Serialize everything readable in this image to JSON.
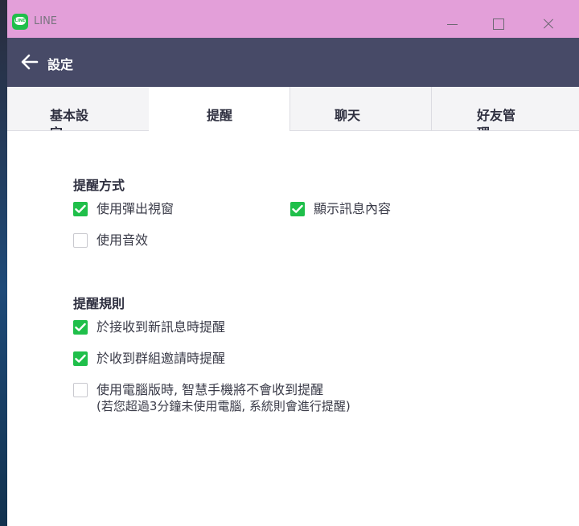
{
  "window": {
    "app_title": "LINE",
    "logo_text": "LINE",
    "accent_color": "#e39fd9",
    "header_color": "#474a67",
    "check_color": "#1fbf4a"
  },
  "header": {
    "title": "設定"
  },
  "tabs": [
    {
      "label": "基本設定",
      "active": false
    },
    {
      "label": "提醒",
      "active": true
    },
    {
      "label": "聊天",
      "active": false
    },
    {
      "label": "好友管理",
      "active": false
    }
  ],
  "sections": {
    "method": {
      "title": "提醒方式",
      "options": [
        {
          "label": "使用彈出視窗",
          "checked": true
        },
        {
          "label": "顯示訊息內容",
          "checked": true
        },
        {
          "label": "使用音效",
          "checked": false
        }
      ]
    },
    "rules": {
      "title": "提醒規則",
      "options": [
        {
          "label": "於接收到新訊息時提醒",
          "checked": true
        },
        {
          "label": "於收到群組邀請時提醒",
          "checked": true
        },
        {
          "label": "使用電腦版時, 智慧手機將不會收到提醒",
          "label_line2": "(若您超過3分鐘未使用電腦, 系統則會進行提醒)",
          "checked": false
        }
      ]
    }
  }
}
